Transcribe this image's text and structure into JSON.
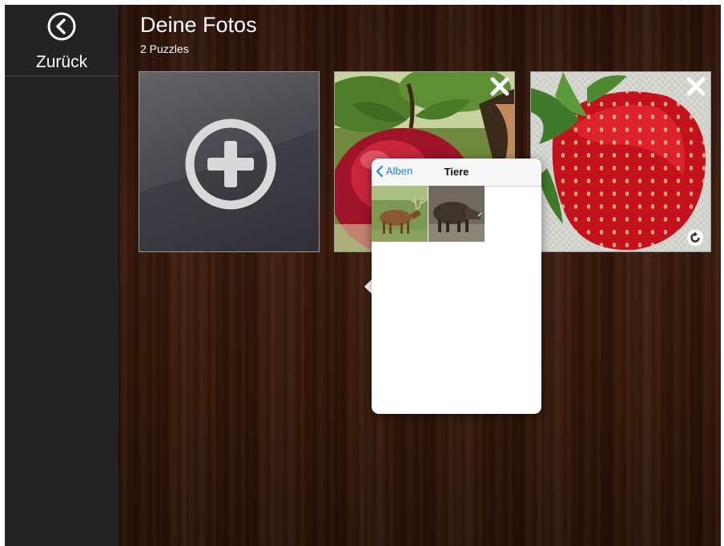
{
  "sidebar": {
    "back_label": "Zurück",
    "back_icon": "chevron-left-circle-icon"
  },
  "header": {
    "title": "Deine Fotos",
    "subtitle": "2 Puzzles"
  },
  "tiles": [
    {
      "type": "add-photo",
      "icon": "plus-circle-icon"
    },
    {
      "type": "puzzle",
      "subject": "apple",
      "actions": [
        "close-icon",
        "rotate-icon"
      ]
    },
    {
      "type": "puzzle",
      "subject": "strawberry",
      "actions": [
        "close-icon",
        "rotate-icon"
      ]
    }
  ],
  "popover": {
    "back_label": "Alben",
    "title": "Tiere",
    "photos": [
      {
        "subject": "deer"
      },
      {
        "subject": "wild-boar"
      }
    ]
  },
  "colors": {
    "link_blue": "#1a7ef5",
    "sidebar": "#232323",
    "wood": "#3e1d0e"
  }
}
